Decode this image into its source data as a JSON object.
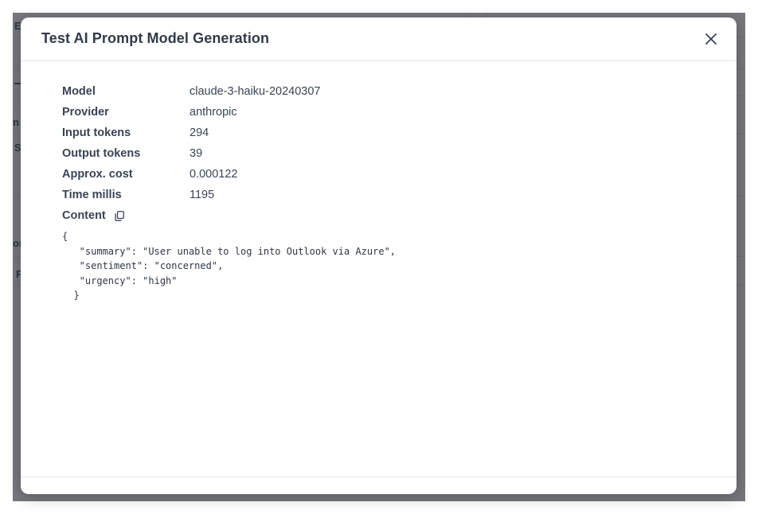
{
  "background": {
    "fragments": [
      "E",
      "n",
      "S",
      "or",
      "F"
    ]
  },
  "modal": {
    "title": "Test AI Prompt Model Generation",
    "fields": [
      {
        "label": "Model",
        "value": "claude-3-haiku-20240307"
      },
      {
        "label": "Provider",
        "value": "anthropic"
      },
      {
        "label": "Input tokens",
        "value": "294"
      },
      {
        "label": "Output tokens",
        "value": "39"
      },
      {
        "label": "Approx. cost",
        "value": "0.000122"
      },
      {
        "label": "Time millis",
        "value": "1195"
      }
    ],
    "content_label": "Content",
    "content": "{\n   \"summary\": \"User unable to log into Outlook via Azure\",\n   \"sentiment\": \"concerned\",\n   \"urgency\": \"high\"\n  }",
    "icons": {
      "close": "close-icon",
      "copy": "copy-icon"
    }
  }
}
